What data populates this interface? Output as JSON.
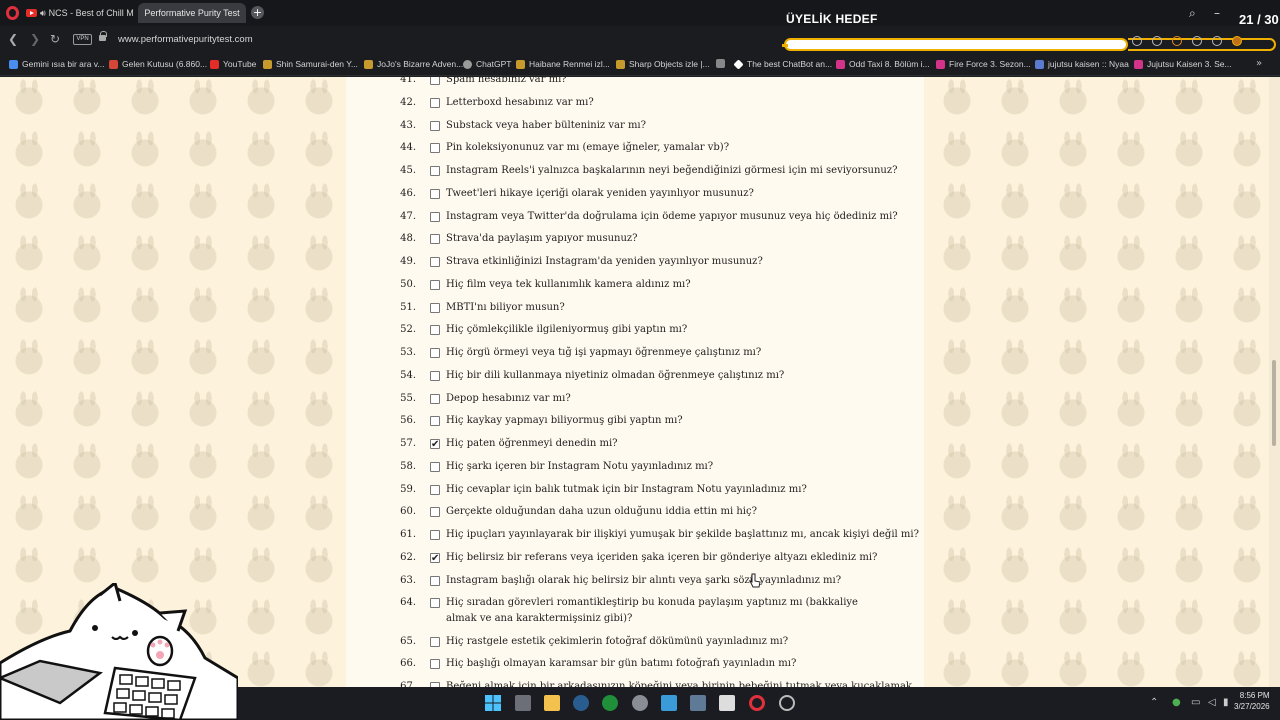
{
  "tabs": [
    {
      "label": "NCS - Best of Chill Mu",
      "active": false
    },
    {
      "label": "Performative Purity Test",
      "active": true
    }
  ],
  "overlay_title": "ÜYELİK HEDEF",
  "overlay_counter": "21 / 30",
  "address": {
    "url": "www.performativepuritytest.com",
    "vpn_label": "VPN"
  },
  "bookmarks": [
    {
      "label": "Gemini ısıa bir ara v...",
      "color": "#4a8df0"
    },
    {
      "label": "Gelen Kutusu (6.860...",
      "color": "#d44638"
    },
    {
      "label": "YouTube",
      "color": "#e52d27"
    },
    {
      "label": "Shin Samurai-den Y...",
      "color": "#c79a2e"
    },
    {
      "label": "JoJo's Bizarre Adven...",
      "color": "#c79a2e"
    },
    {
      "label": "ChatGPT",
      "color": "#9a9a9a"
    },
    {
      "label": "Haibane Renmei izl...",
      "color": "#c79a2e"
    },
    {
      "label": "Sharp Objects izle |...",
      "color": "#c79a2e"
    },
    {
      "label": "",
      "color": "#888"
    },
    {
      "label": "The best ChatBot an...",
      "color": "#ffffff"
    },
    {
      "label": "Odd Taxi 8. Bölüm i...",
      "color": "#d4338a"
    },
    {
      "label": "Fire Force 3. Sezon...",
      "color": "#d4338a"
    },
    {
      "label": "jujutsu kaisen :: Nyaa",
      "color": "#5a7bd0"
    },
    {
      "label": "Jujutsu Kaisen 3. Se...",
      "color": "#d4338a"
    }
  ],
  "questions": [
    {
      "num": "41.",
      "text": "Spam hesabınız var mı?",
      "checked": false
    },
    {
      "num": "42.",
      "text": "Letterboxd hesabınız var mı?",
      "checked": false
    },
    {
      "num": "43.",
      "text": "Substack veya haber bülteniniz var mı?",
      "checked": false
    },
    {
      "num": "44.",
      "text": "Pin koleksiyonunuz var mı (emaye iğneler, yamalar vb)?",
      "checked": false
    },
    {
      "num": "45.",
      "text": "Instagram Reels'i yalnızca başkalarının neyi beğendiğinizi görmesi için mi seviyorsunuz?",
      "checked": false
    },
    {
      "num": "46.",
      "text": "Tweet'leri hikaye içeriği olarak yeniden yayınlıyor musunuz?",
      "checked": false
    },
    {
      "num": "47.",
      "text": "Instagram veya Twitter'da doğrulama için ödeme yapıyor musunuz veya hiç ödediniz mi?",
      "checked": false
    },
    {
      "num": "48.",
      "text": "Strava'da paylaşım yapıyor musunuz?",
      "checked": false
    },
    {
      "num": "49.",
      "text": "Strava etkinliğinizi Instagram'da yeniden yayınlıyor musunuz?",
      "checked": false
    },
    {
      "num": "50.",
      "text": "Hiç film veya tek kullanımlık kamera aldınız mı?",
      "checked": false
    },
    {
      "num": "51.",
      "text": "MBTI'nı biliyor musun?",
      "checked": false
    },
    {
      "num": "52.",
      "text": "Hiç çömlekçilikle ilgileniyormuş gibi yaptın mı?",
      "checked": false
    },
    {
      "num": "53.",
      "text": "Hiç örgü örmeyi veya tığ işi yapmayı öğrenmeye çalıştınız mı?",
      "checked": false
    },
    {
      "num": "54.",
      "text": "Hiç bir dili kullanmaya niyetiniz olmadan öğrenmeye çalıştınız mı?",
      "checked": false
    },
    {
      "num": "55.",
      "text": "Depop hesabınız var mı?",
      "checked": false
    },
    {
      "num": "56.",
      "text": "Hiç kaykay yapmayı biliyormuş gibi yaptın mı?",
      "checked": false
    },
    {
      "num": "57.",
      "text": "Hiç paten öğrenmeyi denedin mi?",
      "checked": true
    },
    {
      "num": "58.",
      "text": "Hiç şarkı içeren bir Instagram Notu yayınladınız mı?",
      "checked": false
    },
    {
      "num": "59.",
      "text": "Hiç cevaplar için balık tutmak için bir Instagram Notu yayınladınız mı?",
      "checked": false
    },
    {
      "num": "60.",
      "text": "Gerçekte olduğundan daha uzun olduğunu iddia ettin mi hiç?",
      "checked": false
    },
    {
      "num": "61.",
      "text": "Hiç ipuçları yayınlayarak bir ilişkiyi yumuşak bir şekilde başlattınız mı, ancak kişiyi değil mi?",
      "checked": false
    },
    {
      "num": "62.",
      "text": "Hiç belirsiz bir referans veya içeriden şaka içeren bir gönderiye altyazı eklediniz mi?",
      "checked": true
    },
    {
      "num": "63.",
      "text": "Instagram başlığı olarak hiç belirsiz bir alıntı veya şarkı sözü yayınladınız mı?",
      "checked": false
    },
    {
      "num": "64.",
      "text": "Hiç sıradan görevleri romantikleştirip bu konuda paylaşım yaptınız mı (bakkaliye almak ve ana karaktermişsiniz gibi)?",
      "checked": false
    },
    {
      "num": "65.",
      "text": "Hiç rastgele estetik çekimlerin fotoğraf dökümünü yayınladınız mı?",
      "checked": false
    },
    {
      "num": "66.",
      "text": "Hiç başlığı olmayan karamsar bir gün batımı fotoğrafı yayınladın mı?",
      "checked": false
    },
    {
      "num": "67.",
      "text": "Beğeni almak için bir arkadaşınızın köpeğini veya birinin bebeğini tutmak veya kucaklamak",
      "checked": false
    }
  ],
  "taskbar": {
    "time": "8:56 PM",
    "date": "3/27/2026"
  },
  "colors": {
    "page_bg": "#fdf3dc",
    "paper": "#fffaf0",
    "overlay_accent": "#f0b000",
    "opera_red": "#e0303c"
  }
}
